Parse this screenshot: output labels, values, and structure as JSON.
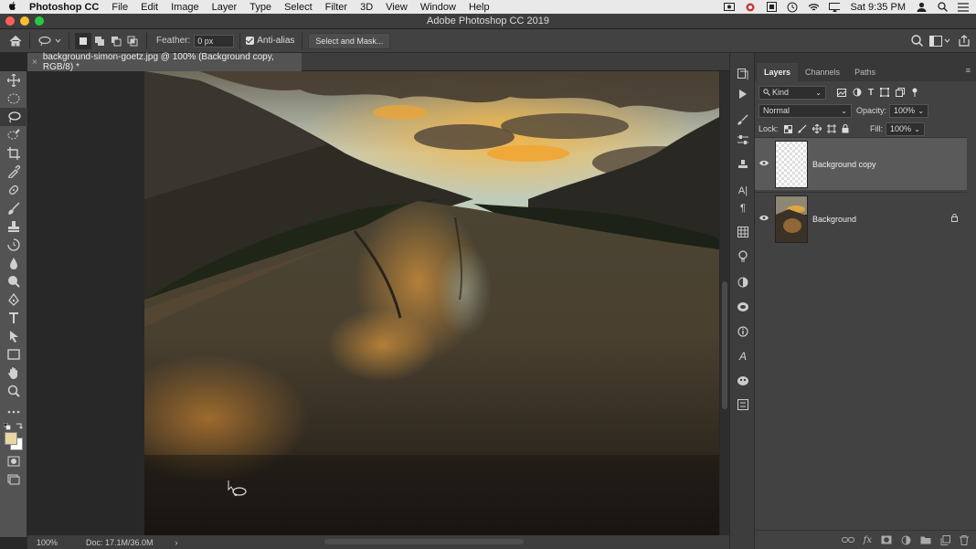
{
  "menubar": {
    "apple": "",
    "app_name": "Photoshop CC",
    "items": [
      "File",
      "Edit",
      "Image",
      "Layer",
      "Type",
      "Select",
      "Filter",
      "3D",
      "View",
      "Window",
      "Help"
    ],
    "clock": "Sat 9:35 PM"
  },
  "window": {
    "title": "Adobe Photoshop CC 2019"
  },
  "options": {
    "feather_label": "Feather:",
    "feather_value": "0 px",
    "anti_alias_label": "Anti-alias",
    "select_mask_label": "Select and Mask..."
  },
  "document": {
    "tab_label": "background-simon-goetz.jpg @ 100% (Background copy, RGB/8) *",
    "zoom": "100%",
    "doc_size": "Doc: 17.1M/36.0M"
  },
  "layers_panel": {
    "tabs": [
      "Layers",
      "Channels",
      "Paths"
    ],
    "filter_kind": "Kind",
    "blend_mode": "Normal",
    "opacity_label": "Opacity:",
    "opacity_value": "100%",
    "lock_label": "Lock:",
    "fill_label": "Fill:",
    "fill_value": "100%",
    "layers": [
      {
        "name": "Background copy",
        "selected": true
      },
      {
        "name": "Background",
        "selected": false,
        "locked": true
      }
    ]
  },
  "colors": {
    "accent": "#e8c873",
    "panel": "#424242",
    "canvas": "#282828"
  }
}
